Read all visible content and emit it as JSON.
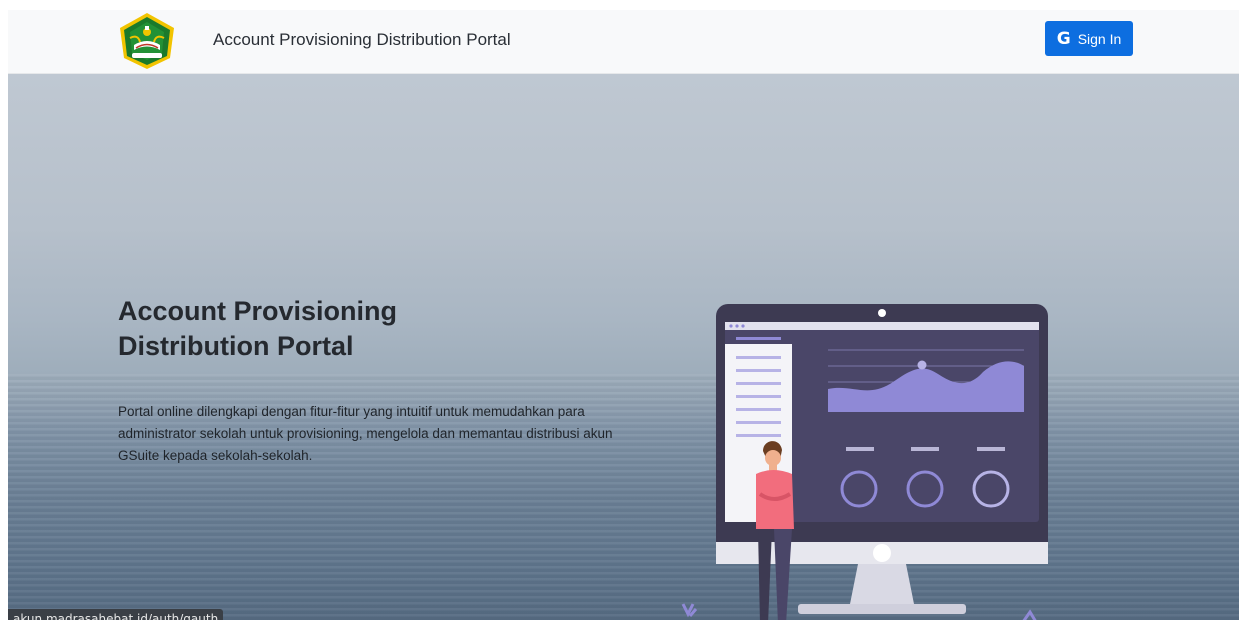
{
  "navbar": {
    "brand": "Account Provisioning Distribution Portal",
    "logo_icon": "ministry-emblem-icon",
    "signin_icon": "google-g-icon",
    "signin_glyph": "G",
    "signin_label": "Sign In"
  },
  "hero": {
    "title": "Account Provisioning Distribution Portal",
    "description": "Portal online dilengkapi dengan fitur-fitur yang intuitif untuk memudahkan para administrator sekolah untuk provisioning, mengelola dan memantau distribusi akun GSuite kepada sekolah-sekolah."
  },
  "status_bar": {
    "url": "akun.madrasahebat.id/auth/gauth"
  },
  "colors": {
    "accent": "#0d6ee0",
    "monitor_dark": "#3d3a52",
    "chart_purple": "#8f89d6"
  }
}
